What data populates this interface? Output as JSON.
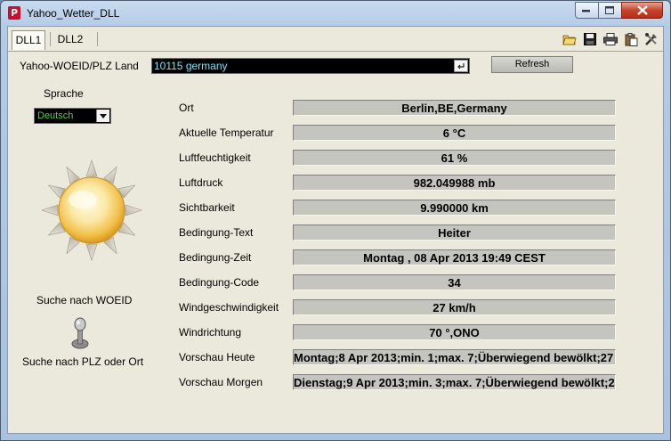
{
  "window": {
    "title": "Yahoo_Wetter_DLL",
    "app_icon_letter": "P"
  },
  "tabs": [
    {
      "label": "DLL1",
      "active": true
    },
    {
      "label": "DLL2",
      "active": false
    }
  ],
  "toolbar": {
    "icons": [
      "open-folder-icon",
      "save-icon",
      "print-icon",
      "clipboard-icon",
      "tools-icon"
    ]
  },
  "search": {
    "label": "Yahoo-WOEID/PLZ Land",
    "value": "10115 germany",
    "refresh_label": "Refresh"
  },
  "language": {
    "label": "Sprache",
    "selected": "Deutsch"
  },
  "mode": {
    "woeid_label": "Suche nach WOEID",
    "plz_label": "Suche nach PLZ oder Ort"
  },
  "fields": [
    {
      "label": "Ort",
      "value": "Berlin,BE,Germany"
    },
    {
      "label": "Aktuelle Temperatur",
      "value": "6 °C"
    },
    {
      "label": "Luftfeuchtigkeit",
      "value": "61 %"
    },
    {
      "label": "Luftdruck",
      "value": "982.049988 mb"
    },
    {
      "label": "Sichtbarkeit",
      "value": "9.990000 km"
    },
    {
      "label": "Bedingung-Text",
      "value": "Heiter"
    },
    {
      "label": "Bedingung-Zeit",
      "value": "Montag , 08 Apr 2013 19:49 CEST"
    },
    {
      "label": "Bedingung-Code",
      "value": "34"
    },
    {
      "label": "Windgeschwindigkeit",
      "value": "27 km/h"
    },
    {
      "label": "Windrichtung",
      "value": "70 °,ONO"
    },
    {
      "label": "Vorschau Heute",
      "value": "Montag;8 Apr 2013;min. 1;max. 7;Überwiegend bewölkt;27"
    },
    {
      "label": "Vorschau Morgen",
      "value": "Dienstag;9 Apr 2013;min. 3;max. 7;Überwiegend bewölkt;2"
    }
  ]
}
